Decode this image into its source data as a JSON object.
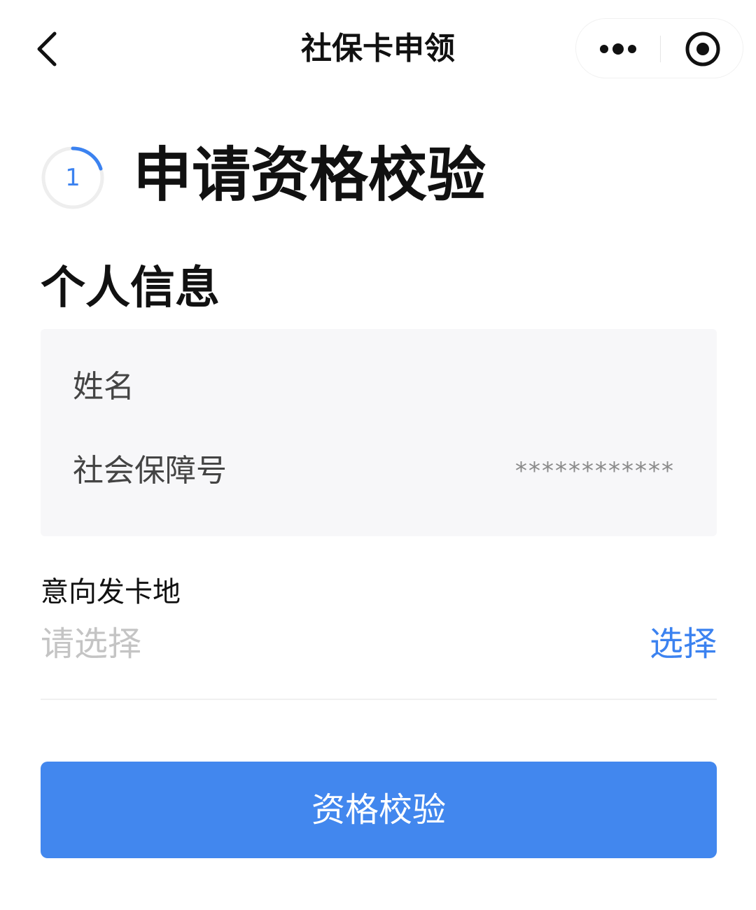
{
  "navbar": {
    "title": "社保卡申领",
    "back_icon": "chevron-left-icon",
    "more_icon": "more-dots-icon",
    "close_icon": "target-close-icon"
  },
  "step": {
    "number": "1",
    "title": "申请资格校验",
    "accent_color": "#3b82f0",
    "progress": 0.2
  },
  "personal_info": {
    "section_title": "个人信息",
    "name_label": "姓名",
    "name_value": "",
    "ssn_label": "社会保障号",
    "ssn_value": "************"
  },
  "card_location": {
    "label": "意向发卡地",
    "placeholder": "请选择",
    "value": "",
    "select_label": "选择"
  },
  "submit": {
    "label": "资格校验",
    "color": "#4287ee"
  }
}
